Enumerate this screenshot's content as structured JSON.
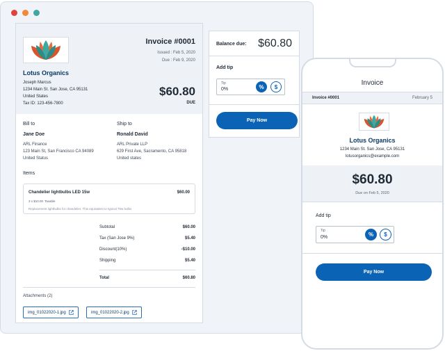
{
  "colors": {
    "window_dots": [
      "#e0433a",
      "#f08a3a",
      "#3fa8a0"
    ],
    "accent": "#0b63b5",
    "logo_teal": "#3fa8a0",
    "logo_orange": "#e86a3a"
  },
  "invoice": {
    "number": "Invoice #0001",
    "issued": "Issued : Feb 5, 2020",
    "due_date": "Due : Feb 9, 2020",
    "company": "Lotus Organics",
    "contact": "Joseph Marcus",
    "address1": "1234 Main St. San Jose, CA 95131",
    "country": "United States",
    "tax_id": "Tax ID: 123-456-7800",
    "amount": "$60.80",
    "due_label": "DUE",
    "bill_to": {
      "title": "Bill to",
      "name": "Jane Doe",
      "company": "ARL Finance",
      "address": "123 Main St, San Francisco CA 94089",
      "country": "United Status"
    },
    "ship_to": {
      "title": "Ship to",
      "name": "Ronald David",
      "company": "ARL Private LLP",
      "address": "629 First Ave, Sacramento, CA 95818",
      "country": "United states"
    },
    "items_title": "Items",
    "item": {
      "name": "Chandelier lightbulbs LED 15w",
      "price": "$60.00",
      "qty": "3 x $10.00",
      "tax": "Taxable",
      "desc": "Replacement lightbulbs for chandelier. This equivalent to typical 75w bulbs"
    },
    "summary": [
      {
        "label": "Subtotal",
        "value": "$60.00"
      },
      {
        "label": "Tax (San Jose 9%)",
        "value": "$5.40"
      },
      {
        "label": "Discount(10%)",
        "value": "-$10.00"
      },
      {
        "label": "Shipping",
        "value": "$5.40"
      }
    ],
    "total": {
      "label": "Total",
      "value": "$60.80"
    },
    "attachments_title": "Attachments (2)",
    "attachments": [
      "img_01022020-1.jpg",
      "img_01022020-2.jpg"
    ]
  },
  "balance": {
    "label": "Balance due:",
    "amount": "$60.80",
    "add_tip": "Add tip",
    "tip_label": "Tip",
    "tip_value": "0%",
    "percent_symbol": "%",
    "dollar_symbol": "$",
    "pay_now": "Pay Now"
  },
  "phone": {
    "title": "Invoice",
    "invoice_no": "Invoice #0001",
    "date": "February 5",
    "company": "Lotus Organics",
    "address": "1234 Main St. San Jose, CA 95131",
    "email": "lotusorganics@example.com",
    "amount": "$60.80",
    "due": "Due on Feb 5, 2020",
    "add_tip": "Add tip",
    "tip_label": "Tip",
    "tip_value": "0%",
    "percent_symbol": "%",
    "dollar_symbol": "$",
    "pay_now": "Pay Now"
  }
}
